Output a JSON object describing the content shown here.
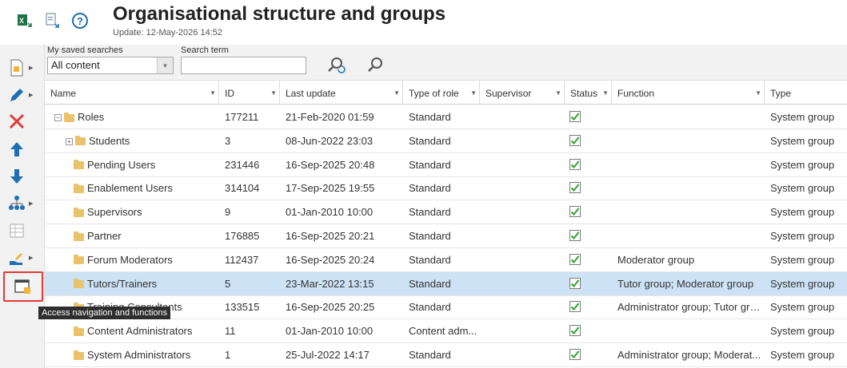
{
  "header": {
    "title": "Organisational structure and groups",
    "update": "Update: 12-May-2026 14:52"
  },
  "search": {
    "saved_label": "My saved searches",
    "saved_value": "All content",
    "term_label": "Search term",
    "term_value": ""
  },
  "tooltip": "Access navigation and functions",
  "columns": [
    "Name",
    "ID",
    "Last update",
    "Type of role",
    "Supervisor",
    "Status",
    "Function",
    "Type"
  ],
  "rows": [
    {
      "name": "Roles",
      "id": "177211",
      "updated": "21-Feb-2020 01:59",
      "role_type": "Standard",
      "supervisor": "",
      "function": "",
      "type": "System group"
    },
    {
      "name": "Students",
      "id": "3",
      "updated": "08-Jun-2022 23:03",
      "role_type": "Standard",
      "supervisor": "",
      "function": "",
      "type": "System group"
    },
    {
      "name": "Pending Users",
      "id": "231446",
      "updated": "16-Sep-2025 20:48",
      "role_type": "Standard",
      "supervisor": "",
      "function": "",
      "type": "System group"
    },
    {
      "name": "Enablement Users",
      "id": "314104",
      "updated": "17-Sep-2025 19:55",
      "role_type": "Standard",
      "supervisor": "",
      "function": "",
      "type": "System group"
    },
    {
      "name": "Supervisors",
      "id": "9",
      "updated": "01-Jan-2010 10:00",
      "role_type": "Standard",
      "supervisor": "",
      "function": "",
      "type": "System group"
    },
    {
      "name": "Partner",
      "id": "176885",
      "updated": "16-Sep-2025 20:21",
      "role_type": "Standard",
      "supervisor": "",
      "function": "",
      "type": "System group"
    },
    {
      "name": "Forum Moderators",
      "id": "112437",
      "updated": "16-Sep-2025 20:24",
      "role_type": "Standard",
      "supervisor": "",
      "function": "Moderator group",
      "type": "System group"
    },
    {
      "name": "Tutors/Trainers",
      "id": "5",
      "updated": "23-Mar-2022 13:15",
      "role_type": "Standard",
      "supervisor": "",
      "function": "Tutor group; Moderator group",
      "type": "System group"
    },
    {
      "name": "Training Consultants",
      "id": "133515",
      "updated": "16-Sep-2025 20:25",
      "role_type": "Standard",
      "supervisor": "",
      "function": "Administrator group; Tutor gro...",
      "type": "System group"
    },
    {
      "name": "Content Administrators",
      "id": "11",
      "updated": "01-Jan-2010 10:00",
      "role_type": "Content adm...",
      "supervisor": "",
      "function": "",
      "type": "System group"
    },
    {
      "name": "System Administrators",
      "id": "1",
      "updated": "25-Jul-2022 14:17",
      "role_type": "Standard",
      "supervisor": "",
      "function": "Administrator group; Moderat...",
      "type": "System group"
    }
  ],
  "colors": {
    "accent": "#1f6fb2",
    "selected_row": "#cde2f5",
    "active_outline": "#e53935"
  }
}
